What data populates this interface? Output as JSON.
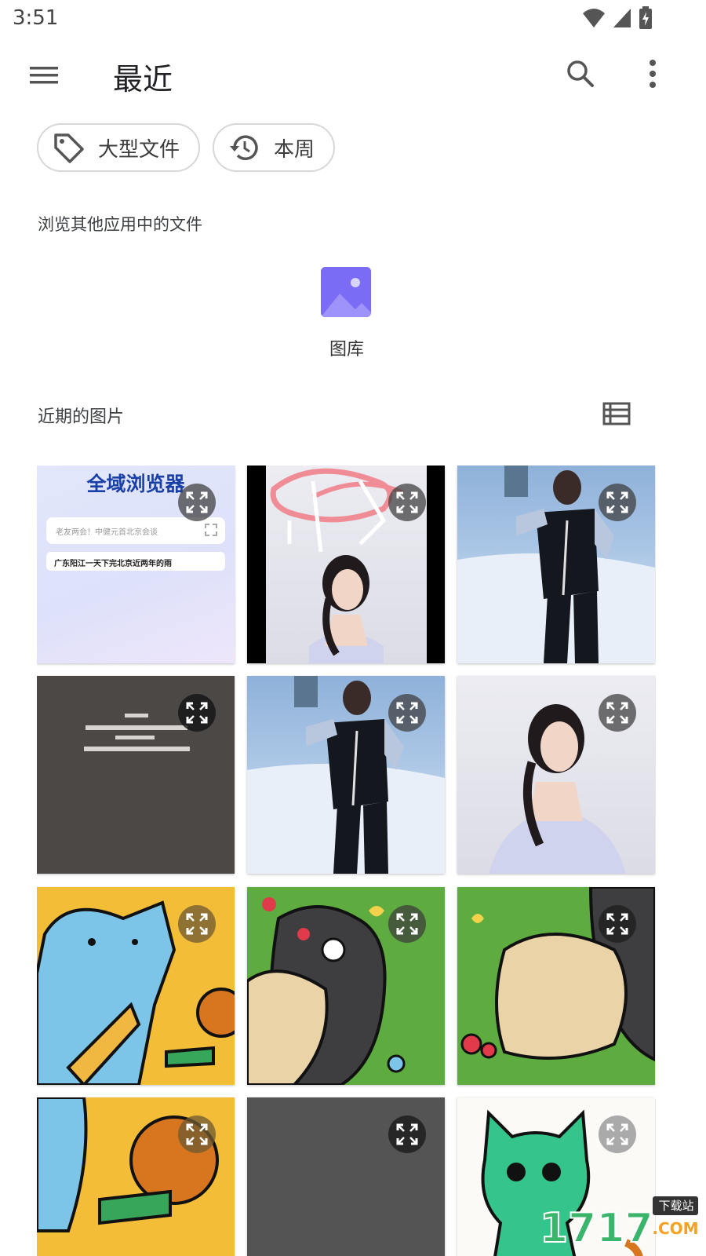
{
  "status_bar": {
    "time": "3:51"
  },
  "app_bar": {
    "title": "最近"
  },
  "chips": [
    {
      "label": "大型文件",
      "icon": "tag-icon"
    },
    {
      "label": "本周",
      "icon": "history-icon"
    }
  ],
  "browse_section": {
    "label": "浏览其他应用中的文件"
  },
  "apps": [
    {
      "label": "图库",
      "icon": "gallery-icon"
    }
  ],
  "recent_section": {
    "label": "近期的图片"
  },
  "thumbnails": [
    {
      "title": "全域浏览器",
      "search_placeholder": "老友两会！中健元首北京会谈",
      "headline": "广东阳江一天下完北京近两年的雨"
    },
    {
      "description": "photo"
    },
    {
      "description": "photo"
    },
    {
      "description": "dark text image"
    },
    {
      "description": "photo"
    },
    {
      "description": "photo"
    },
    {
      "description": "cartoon"
    },
    {
      "description": "cartoon"
    },
    {
      "description": "cartoon"
    },
    {
      "description": "cartoon"
    },
    {
      "description": "dark image"
    },
    {
      "description": "cartoon cat"
    }
  ],
  "watermark": {
    "text": "下载站"
  },
  "colors": {
    "accent": "#7a6cf5",
    "chip_border": "#d7d7d7"
  }
}
